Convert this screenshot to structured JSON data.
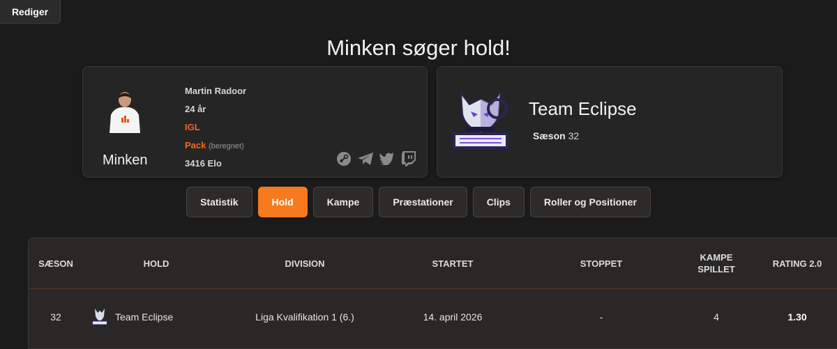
{
  "edit_button": "Rediger",
  "title": "Minken søger hold!",
  "player": {
    "nickname": "Minken",
    "real_name": "Martin Radoor",
    "age": "24 år",
    "role": "IGL",
    "playstyle": "Pack",
    "playstyle_note": "(beregnet)",
    "elo": "3416 Elo",
    "socials": [
      "steam-icon",
      "telegram-icon",
      "twitter-icon",
      "twitch-icon"
    ]
  },
  "team": {
    "name": "Team Eclipse",
    "season_label": "Sæson",
    "season_value": "32"
  },
  "tabs": [
    {
      "label": "Statistik",
      "active": false
    },
    {
      "label": "Hold",
      "active": true
    },
    {
      "label": "Kampe",
      "active": false
    },
    {
      "label": "Præstationer",
      "active": false
    },
    {
      "label": "Clips",
      "active": false
    },
    {
      "label": "Roller og Positioner",
      "active": false
    }
  ],
  "table": {
    "headers": {
      "season": "SÆSON",
      "team": "HOLD",
      "division": "DIVISION",
      "started": "STARTET",
      "stopped": "STOPPET",
      "matches_line1": "KAMPE",
      "matches_line2": "SPILLET",
      "rating": "RATING 2.0"
    },
    "rows": [
      {
        "season": "32",
        "team": "Team Eclipse",
        "division": "Liga Kvalifikation 1 (6.)",
        "started": "14. april 2026",
        "stopped": "-",
        "matches": "4",
        "rating": "1.30"
      }
    ]
  },
  "colors": {
    "accent": "#f77a1e",
    "background": "#1c1b1b",
    "card": "#262525"
  }
}
